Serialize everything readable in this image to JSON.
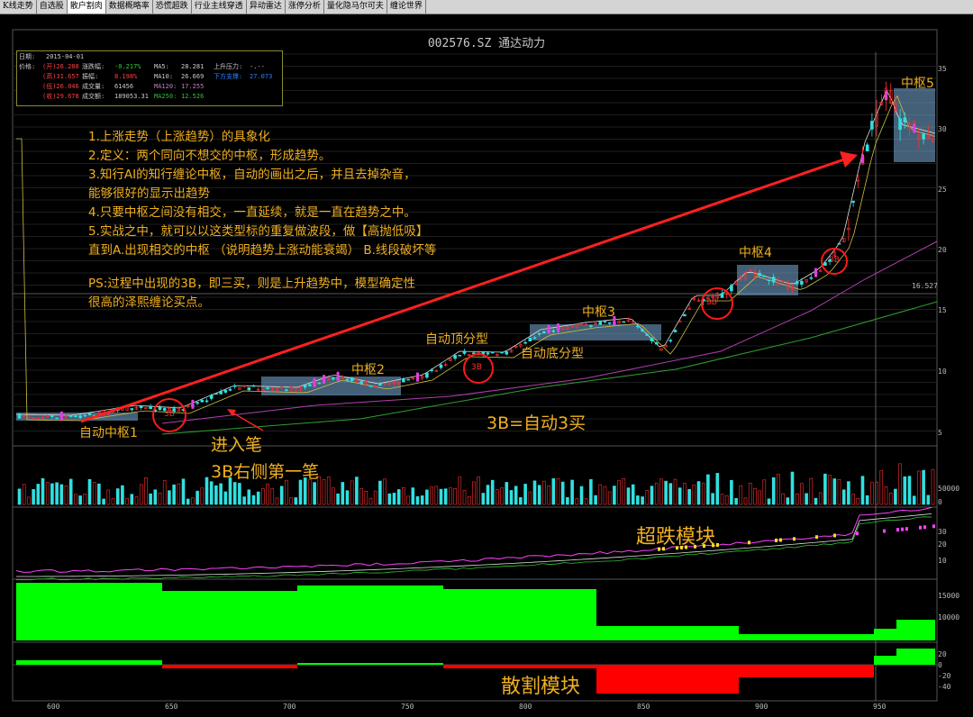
{
  "tabs": [
    "K线走势",
    "自选股",
    "散户割肉",
    "数据概略率",
    "恐慌超跌",
    "行业主线穿透",
    "异动雷达",
    "涨停分析",
    "量化隐马尔可夫",
    "缠论世界"
  ],
  "active_tab": 2,
  "chart_title": "002576.SZ 通达动力",
  "info": {
    "date_label": "日期:",
    "date": "2015-04-01",
    "price_label": "价格:",
    "open": "(开)26.288",
    "high": "(高)31.657",
    "low": "(低)26.046",
    "close": "(收)29.678",
    "change_label": "涨跌幅:",
    "change": "-0.217%",
    "amplitude_label": "振幅:",
    "amplitude": "8.198%",
    "volume_label": "成交量:",
    "volume": "61456",
    "amount_label": "成交额:",
    "amount": "189053.31",
    "ma5_label": "MA5:",
    "ma5": "28.281",
    "ma10_label": "MA10:",
    "ma10": "26.669",
    "ma120_label": "MA120:",
    "ma120": "17.255",
    "ma250_label": "MA250:",
    "ma250": "12.526",
    "upper_label": "上升压力:",
    "upper": "-.--",
    "lower_label": "下方支撑:",
    "lower": "27.073"
  },
  "notes": [
    "1.上涨走势（上涨趋势）的具象化",
    "2.定义：两个同向不想交的中枢，形成趋势。",
    "3.知行AI的知行缠论中枢，自动的画出之后，并且去掉杂音，",
    "能够很好的显示出趋势",
    "4.只要中枢之间没有相交，一直延续，就是一直在趋势之中。",
    "5.实战之中，就可以以这类型标的重复做波段，做【高抛低吸】",
    "直到A.出现相交的中枢 （说明趋势上涨动能衰竭） B.线段破坏等",
    "",
    "PS:过程中出现的3B，即三买，则是上升趋势中，模型确定性",
    "很高的泽熙缠论买点。"
  ],
  "annotations": {
    "zhongshu1": "自动中枢1",
    "zhongshu2": "中枢2",
    "zhongshu3": "中枢3",
    "zhongshu4": "中枢4",
    "zhongshu5": "中枢5",
    "top_fractal": "自动顶分型",
    "bottom_fractal": "自动底分型",
    "entry_1": "进入笔",
    "entry_2": "3B右侧第一笔",
    "definition_3b": "3B=自动3买",
    "oversold_module": "超跌模块",
    "split_module": "散割模块",
    "marker_3b": "3B"
  },
  "price_axis": [
    "35",
    "30",
    "25",
    "20",
    "15",
    "10",
    "5"
  ],
  "price_marker": "16.527",
  "volume_axis": [
    "50000",
    "0"
  ],
  "oversold_axis": [
    "30",
    "20",
    "10"
  ],
  "green_axis": [
    "15000",
    "10000"
  ],
  "split_axis": [
    "20",
    "0",
    "-20",
    "-40"
  ],
  "x_axis": [
    "600",
    "650",
    "700",
    "750",
    "800",
    "850",
    "900",
    "950"
  ],
  "colors": {
    "up": "#ff3030",
    "down": "#30e0e0",
    "annotation": "#f0b020",
    "box": "#6fa0c8",
    "bright_green": "#00ff00",
    "red": "#ff0000",
    "grid": "#1e1e1e",
    "panel_border": "#555555"
  }
}
